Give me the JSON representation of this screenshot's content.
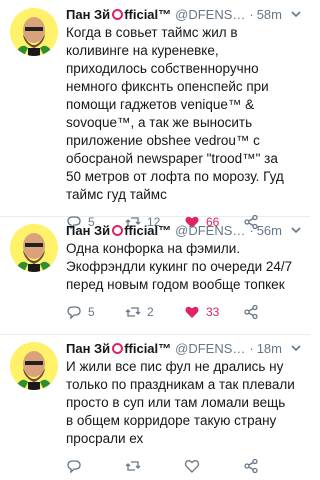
{
  "tweets": [
    {
      "name": "Пан Зй",
      "official": "fficial™",
      "handle": "@DFENS3...",
      "time": "58m",
      "text": "Когда в совьет таймс жил в коливинге на куреневке, приходилось собственноручно немного фикснть опенспейс при помощи гаджетов venique™ & sovoque™, а так же выносить приложение obshee vedrou™ с обосраной newspaper \"trood™\" за 50 метров от лофта по морозу. Гуд таймс гуд таймс",
      "replies": "5",
      "retweets": "12",
      "likes": "66"
    },
    {
      "name": "Пан Зй",
      "official": "fficial™",
      "handle": "@DFENS3...",
      "time": "56m",
      "text": "Одна конфорка на фэмили. Экофрэндли кукинг по очереди 24/7 перед новым годом вообще топкек",
      "replies": "5",
      "retweets": "2",
      "likes": "33"
    },
    {
      "name": "Пан Зй",
      "official": "fficial™",
      "handle": "@DFENS3...",
      "time": "18m",
      "text": "И жили все пис фул не дрались ну только по праздникам а так плевали просто в суп или там ломали вещь в общем корридоре такую страну просрали ех",
      "replies": "",
      "retweets": "",
      "likes": ""
    }
  ],
  "colors": {
    "like_active": "#e0245e",
    "secondary": "#657786",
    "avatar_bg": "#fff26a"
  }
}
